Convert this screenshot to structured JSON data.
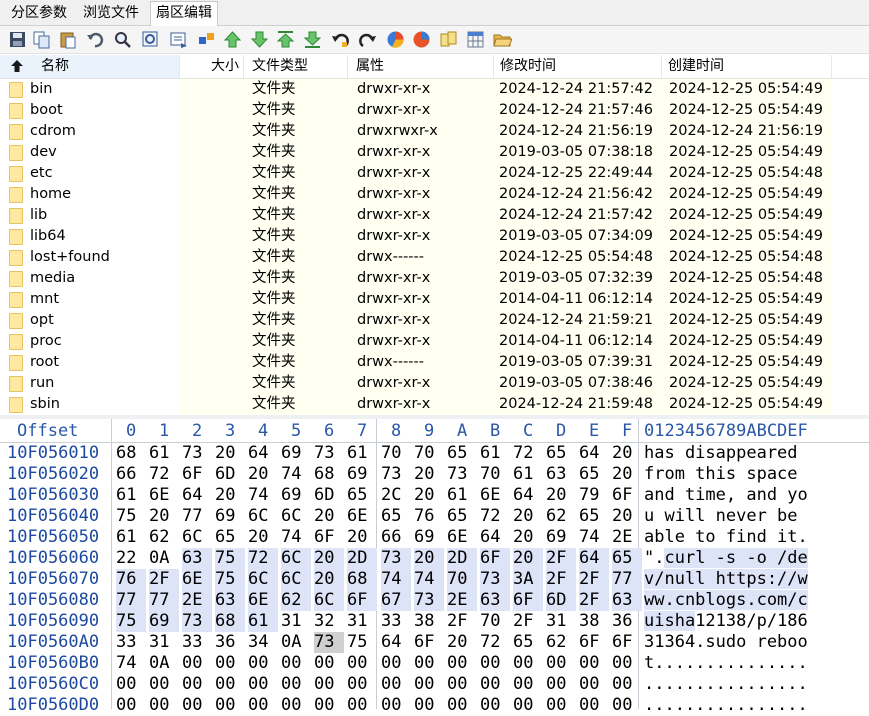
{
  "tabs": [
    {
      "label": "分区参数",
      "active": false
    },
    {
      "label": "浏览文件",
      "active": false
    },
    {
      "label": "扇区编辑",
      "active": true
    }
  ],
  "toolbar": [
    "save-icon",
    "copy-icon",
    "paste-icon",
    "undo-icon",
    "search-icon",
    "find-replace-icon",
    "goto-icon",
    "jump-icon",
    "nav-up-icon",
    "nav-down-icon",
    "nav-top-icon",
    "nav-bottom-icon",
    "go-back-icon",
    "go-forward-icon",
    "partition-icon",
    "disk-icon",
    "copy-sector-icon",
    "grid-icon",
    "open-folder-icon"
  ],
  "columns": {
    "name": "名称",
    "size": "大小",
    "type": "文件类型",
    "attr": "属性",
    "modified": "修改时间",
    "created": "创建时间"
  },
  "files": [
    {
      "name": "bin",
      "type": "文件夹",
      "attr": "drwxr-xr-x",
      "modified": "2024-12-24 21:57:42",
      "created": "2024-12-25 05:54:49"
    },
    {
      "name": "boot",
      "type": "文件夹",
      "attr": "drwxr-xr-x",
      "modified": "2024-12-24 21:57:46",
      "created": "2024-12-25 05:54:49"
    },
    {
      "name": "cdrom",
      "type": "文件夹",
      "attr": "drwxrwxr-x",
      "modified": "2024-12-24 21:56:19",
      "created": "2024-12-24 21:56:19"
    },
    {
      "name": "dev",
      "type": "文件夹",
      "attr": "drwxr-xr-x",
      "modified": "2019-03-05 07:38:18",
      "created": "2024-12-25 05:54:49"
    },
    {
      "name": "etc",
      "type": "文件夹",
      "attr": "drwxr-xr-x",
      "modified": "2024-12-25 22:49:44",
      "created": "2024-12-25 05:54:48"
    },
    {
      "name": "home",
      "type": "文件夹",
      "attr": "drwxr-xr-x",
      "modified": "2024-12-24 21:56:42",
      "created": "2024-12-25 05:54:49"
    },
    {
      "name": "lib",
      "type": "文件夹",
      "attr": "drwxr-xr-x",
      "modified": "2024-12-24 21:57:42",
      "created": "2024-12-25 05:54:49"
    },
    {
      "name": "lib64",
      "type": "文件夹",
      "attr": "drwxr-xr-x",
      "modified": "2019-03-05 07:34:09",
      "created": "2024-12-25 05:54:49"
    },
    {
      "name": "lost+found",
      "type": "文件夹",
      "attr": "drwx------",
      "modified": "2024-12-25 05:54:48",
      "created": "2024-12-25 05:54:48"
    },
    {
      "name": "media",
      "type": "文件夹",
      "attr": "drwxr-xr-x",
      "modified": "2019-03-05 07:32:39",
      "created": "2024-12-25 05:54:48"
    },
    {
      "name": "mnt",
      "type": "文件夹",
      "attr": "drwxr-xr-x",
      "modified": "2014-04-11 06:12:14",
      "created": "2024-12-25 05:54:49"
    },
    {
      "name": "opt",
      "type": "文件夹",
      "attr": "drwxr-xr-x",
      "modified": "2024-12-24 21:59:21",
      "created": "2024-12-25 05:54:49"
    },
    {
      "name": "proc",
      "type": "文件夹",
      "attr": "drwxr-xr-x",
      "modified": "2014-04-11 06:12:14",
      "created": "2024-12-25 05:54:49"
    },
    {
      "name": "root",
      "type": "文件夹",
      "attr": "drwx------",
      "modified": "2019-03-05 07:39:31",
      "created": "2024-12-25 05:54:49"
    },
    {
      "name": "run",
      "type": "文件夹",
      "attr": "drwxr-xr-x",
      "modified": "2019-03-05 07:38:46",
      "created": "2024-12-25 05:54:49"
    },
    {
      "name": "sbin",
      "type": "文件夹",
      "attr": "drwxr-xr-x",
      "modified": "2024-12-24 21:59:48",
      "created": "2024-12-25 05:54:49"
    }
  ],
  "hex": {
    "offset_label": "Offset",
    "col_labels": [
      "0",
      "1",
      "2",
      "3",
      "4",
      "5",
      "6",
      "7",
      "8",
      "9",
      "A",
      "B",
      "C",
      "D",
      "E",
      "F"
    ],
    "text_header": "0123456789ABCDEF",
    "rows": [
      {
        "offset": "10F056010",
        "bytes": [
          "68",
          "61",
          "73",
          "20",
          "64",
          "69",
          "73",
          "61",
          "70",
          "70",
          "65",
          "61",
          "72",
          "65",
          "64",
          "20"
        ],
        "text": "has disappeared "
      },
      {
        "offset": "10F056020",
        "bytes": [
          "66",
          "72",
          "6F",
          "6D",
          "20",
          "74",
          "68",
          "69",
          "73",
          "20",
          "73",
          "70",
          "61",
          "63",
          "65",
          "20"
        ],
        "text": "from this space "
      },
      {
        "offset": "10F056030",
        "bytes": [
          "61",
          "6E",
          "64",
          "20",
          "74",
          "69",
          "6D",
          "65",
          "2C",
          "20",
          "61",
          "6E",
          "64",
          "20",
          "79",
          "6F"
        ],
        "text": "and time, and yo"
      },
      {
        "offset": "10F056040",
        "bytes": [
          "75",
          "20",
          "77",
          "69",
          "6C",
          "6C",
          "20",
          "6E",
          "65",
          "76",
          "65",
          "72",
          "20",
          "62",
          "65",
          "20"
        ],
        "text": "u will never be "
      },
      {
        "offset": "10F056050",
        "bytes": [
          "61",
          "62",
          "6C",
          "65",
          "20",
          "74",
          "6F",
          "20",
          "66",
          "69",
          "6E",
          "64",
          "20",
          "69",
          "74",
          "2E"
        ],
        "text": "able to find it."
      },
      {
        "offset": "10F056060",
        "bytes": [
          "22",
          "0A",
          "63",
          "75",
          "72",
          "6C",
          "20",
          "2D",
          "73",
          "20",
          "2D",
          "6F",
          "20",
          "2F",
          "64",
          "65"
        ],
        "text": "\".curl -s -o /de"
      },
      {
        "offset": "10F056070",
        "bytes": [
          "76",
          "2F",
          "6E",
          "75",
          "6C",
          "6C",
          "20",
          "68",
          "74",
          "74",
          "70",
          "73",
          "3A",
          "2F",
          "2F",
          "77"
        ],
        "text": "v/null https://w"
      },
      {
        "offset": "10F056080",
        "bytes": [
          "77",
          "77",
          "2E",
          "63",
          "6E",
          "62",
          "6C",
          "6F",
          "67",
          "73",
          "2E",
          "63",
          "6F",
          "6D",
          "2F",
          "63"
        ],
        "text": "ww.cnblogs.com/c"
      },
      {
        "offset": "10F056090",
        "bytes": [
          "75",
          "69",
          "73",
          "68",
          "61",
          "31",
          "32",
          "31",
          "33",
          "38",
          "2F",
          "70",
          "2F",
          "31",
          "38",
          "36"
        ],
        "text": "uisha12138/p/186"
      },
      {
        "offset": "10F0560A0",
        "bytes": [
          "33",
          "31",
          "33",
          "36",
          "34",
          "0A",
          "73",
          "75",
          "64",
          "6F",
          "20",
          "72",
          "65",
          "62",
          "6F",
          "6F"
        ],
        "text": "31364.sudo reboo"
      },
      {
        "offset": "10F0560B0",
        "bytes": [
          "74",
          "0A",
          "00",
          "00",
          "00",
          "00",
          "00",
          "00",
          "00",
          "00",
          "00",
          "00",
          "00",
          "00",
          "00",
          "00"
        ],
        "text": "t..............."
      },
      {
        "offset": "10F0560C0",
        "bytes": [
          "00",
          "00",
          "00",
          "00",
          "00",
          "00",
          "00",
          "00",
          "00",
          "00",
          "00",
          "00",
          "00",
          "00",
          "00",
          "00"
        ],
        "text": "................"
      },
      {
        "offset": "10F0560D0",
        "bytes": [
          "00",
          "00",
          "00",
          "00",
          "00",
          "00",
          "00",
          "00",
          "00",
          "00",
          "00",
          "00",
          "00",
          "00",
          "00",
          "00"
        ],
        "text": "................"
      }
    ]
  },
  "colors": {
    "selection": "#dde4f8",
    "offset_blue": "#1d4aa0",
    "cursor": "#d0d0d0"
  }
}
